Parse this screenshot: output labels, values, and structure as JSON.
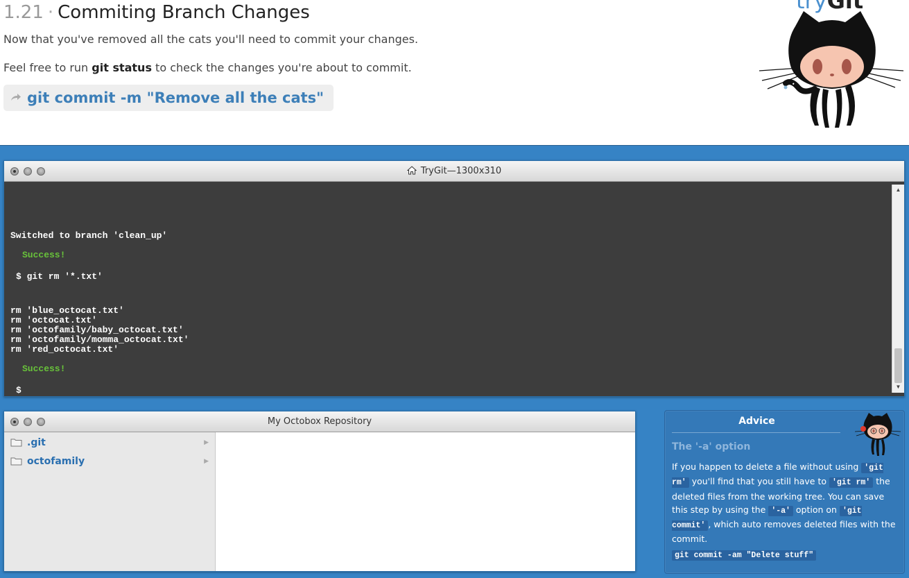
{
  "header": {
    "lesson_number": "1.21",
    "lesson_separator": "·",
    "lesson_title": "Commiting Branch Changes",
    "instruction_1": "Now that you've removed all the cats you'll need to commit your changes.",
    "instruction_2_prefix": "Feel free to run ",
    "instruction_2_bold": "git status",
    "instruction_2_suffix": " to check the changes you're about to commit.",
    "command": "git commit -m \"Remove all the cats\"",
    "brand_try": "try",
    "brand_git": "Git"
  },
  "terminal": {
    "title": "TryGit—1300x310",
    "lines": [
      "Switched to branch 'clean_up'",
      "Success!",
      "$ git rm '*.txt'",
      "rm 'blue_octocat.txt'",
      "rm 'octocat.txt'",
      "rm 'octofamily/baby_octocat.txt'",
      "rm 'octofamily/momma_octocat.txt'",
      "rm 'red_octocat.txt'",
      "Success!",
      "$"
    ],
    "scroll_up": "▲",
    "scroll_down": "▼"
  },
  "repo": {
    "title": "My Octobox Repository",
    "folders": [
      {
        "label": ".git",
        "arrow": "▶"
      },
      {
        "label": "octofamily",
        "arrow": "▶"
      }
    ]
  },
  "advice": {
    "title": "Advice",
    "heading": "The '-a' option",
    "t1": "If you happen to delete a file without using ",
    "c1": "'git rm'",
    "t2": " you'll find that you still have to ",
    "c2": "'git rm'",
    "t3": " the deleted files from the working tree. You can save this step by using the ",
    "c3": "'-a'",
    "t4": " option on ",
    "c4": "'git commit'",
    "t5": ", which auto removes deleted files with the commit.",
    "example": "git commit -am \"Delete stuff\""
  },
  "colors": {
    "accent_blue": "#3683c5",
    "command_blue": "#3d7fb8",
    "terminal_bg": "#3d3d3d",
    "success_green": "#68c23a",
    "folder_blue": "#2a6fb0"
  },
  "icons": [
    "octocat-logo",
    "home-icon",
    "folder-icon",
    "chevron-right-icon",
    "share-arrow-icon"
  ]
}
